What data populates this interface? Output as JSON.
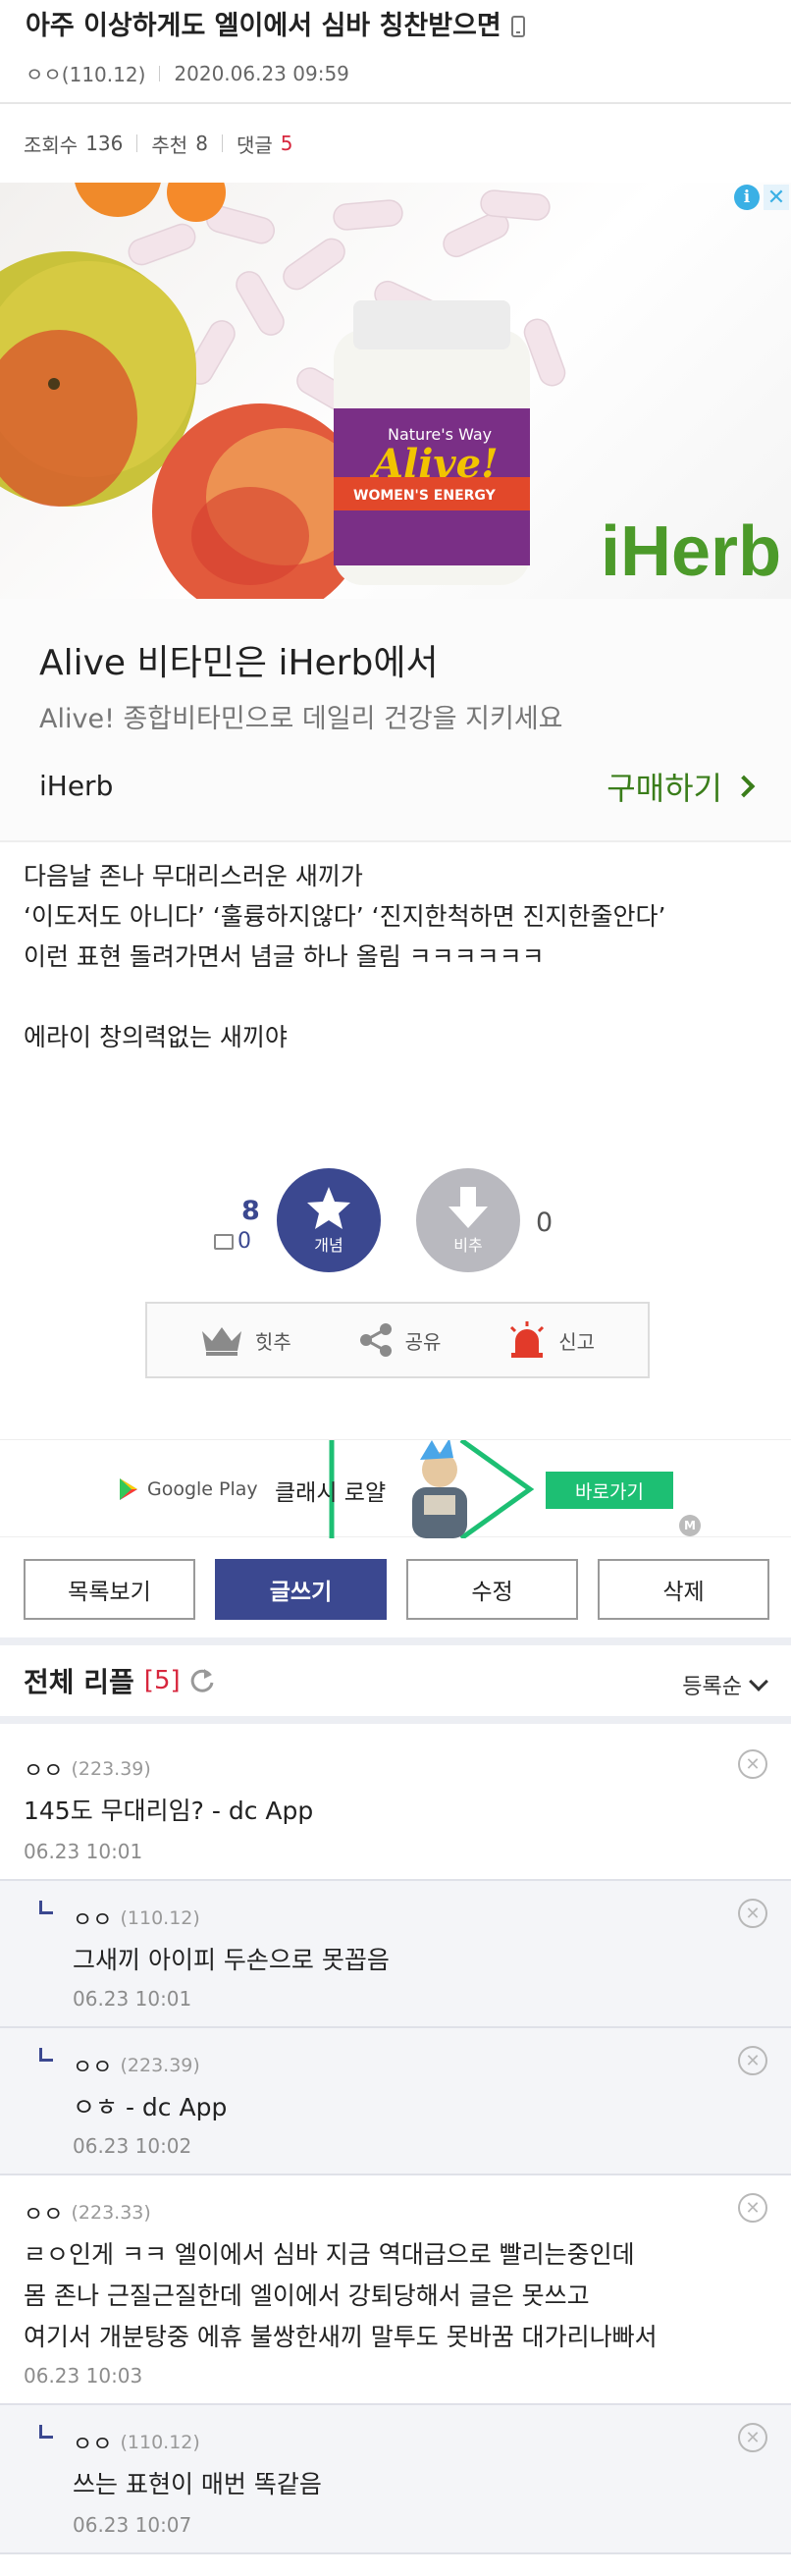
{
  "post": {
    "title": "아주 이상하게도 엘이에서 심바 칭찬받으면",
    "author": "ㅇㅇ(110.12)",
    "datetime": "2020.06.23 09:59",
    "views_label": "조회수",
    "views": "136",
    "recommend_label": "추천",
    "recommend": "8",
    "comments_label": "댓글",
    "comments": "5",
    "body": [
      "다음날 존나 무대리스러운 새끼가",
      "‘이도저도 아니다’ ‘훌륭하지않다’ ‘진지한척하면 진지한줄안다’",
      "이런 표현 돌려가면서 념글 하나 올림 ㅋㅋㅋㅋㅋㅋ",
      "",
      "에라이 창의력없는 새끼야"
    ]
  },
  "ad": {
    "image_brand_text": "iHerb",
    "bottle_brand": "Nature's Way",
    "bottle_name": "Alive!",
    "bottle_sub": "WOMEN'S ENERGY",
    "title": "Alive 비타민은 iHerb에서",
    "description": "Alive! 종합비타민으로 데일리 건강을 지키세요",
    "brand": "iHerb",
    "cta": "구매하기",
    "info_badge": "i",
    "close_badge": "✕"
  },
  "vote": {
    "up_count": "8",
    "fix_count": "0",
    "up_label": "개념",
    "down_label": "비추",
    "down_count": "0"
  },
  "actions": {
    "hit_label": "힛추",
    "share_label": "공유",
    "report_label": "신고"
  },
  "game_ad": {
    "store": "Google Play",
    "name": "클래시 로얄",
    "button": "바로가기",
    "m_badge": "M"
  },
  "buttons": {
    "list": "목록보기",
    "write": "글쓰기",
    "edit": "수정",
    "delete": "삭제"
  },
  "replies": {
    "title": "전체 리플",
    "count": "[5]",
    "sort": "등록순",
    "items": [
      {
        "author": "ㅇㅇ",
        "ip": "(223.39)",
        "lines": [
          "145도 무대리임? - dc App"
        ],
        "date": "06.23 10:01"
      },
      {
        "author": "ㅇㅇ",
        "ip": "(110.12)",
        "lines": [
          "그새끼 아이피 두손으로 못꼽음"
        ],
        "date": "06.23 10:01"
      },
      {
        "author": "ㅇㅇ",
        "ip": "(223.39)",
        "lines": [
          "ㅇㅎ - dc App"
        ],
        "date": "06.23 10:02"
      },
      {
        "author": "ㅇㅇ",
        "ip": "(223.33)",
        "lines": [
          "ㄹㅇ인게 ㅋㅋ 엘이에서 심바 지금 역대급으로 빨리는중인데",
          "몸 존나 근질근질한데 엘이에서 강퇴당해서 글은 못쓰고",
          "여기서 개분탕중 에휴 불쌍한새끼 말투도 못바꿈 대가리나빠서"
        ],
        "date": "06.23 10:03"
      },
      {
        "author": "ㅇㅇ",
        "ip": "(110.12)",
        "lines": [
          "쓰는 표현이 매번 똑같음"
        ],
        "date": "06.23 10:07"
      }
    ]
  },
  "colors": {
    "primary": "#3b4890",
    "red": "#d7263d",
    "green": "#3a7d1a",
    "iherb_green": "#4c9a2a"
  }
}
